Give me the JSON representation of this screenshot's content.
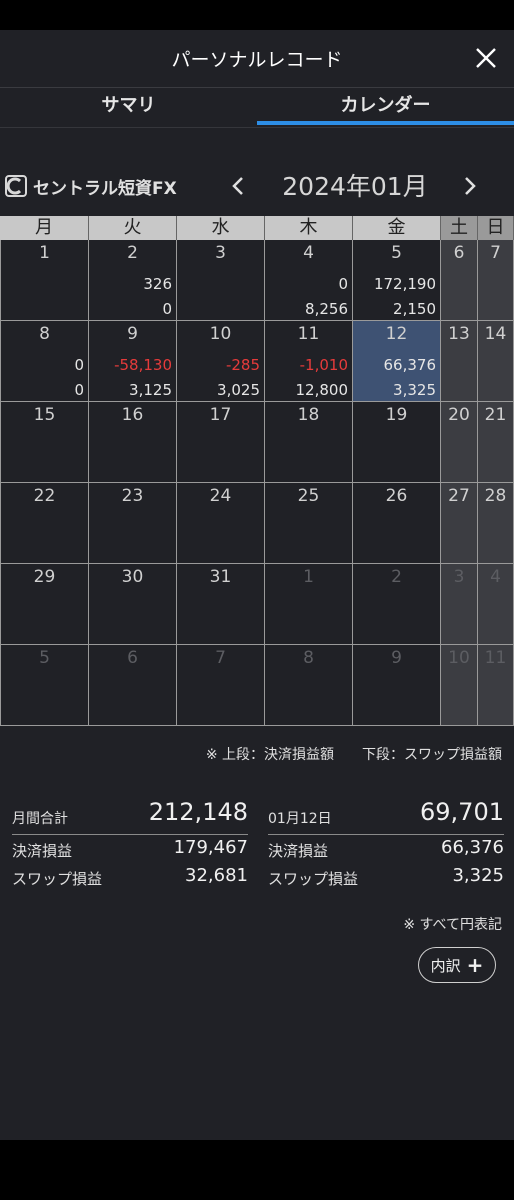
{
  "header": {
    "title": "パーソナルレコード"
  },
  "tabs": [
    {
      "label": "サマリ",
      "active": false
    },
    {
      "label": "カレンダー",
      "active": true
    }
  ],
  "brand": {
    "logo_text": "セントラル短資FX"
  },
  "month_nav": {
    "label": "2024年01月",
    "prev": "‹",
    "next": "›"
  },
  "calendar": {
    "weekdays": [
      "月",
      "火",
      "水",
      "木",
      "金",
      "土",
      "日"
    ],
    "weeks": [
      [
        {
          "day": "1",
          "top": "",
          "bottom": ""
        },
        {
          "day": "2",
          "top": "326",
          "bottom": "0"
        },
        {
          "day": "3",
          "top": "",
          "bottom": ""
        },
        {
          "day": "4",
          "top": "0",
          "bottom": "8,256"
        },
        {
          "day": "5",
          "top": "172,190",
          "bottom": "2,150"
        },
        {
          "day": "6",
          "top": "",
          "bottom": ""
        },
        {
          "day": "7",
          "top": "",
          "bottom": ""
        }
      ],
      [
        {
          "day": "8",
          "top": "0",
          "bottom": "0"
        },
        {
          "day": "9",
          "top": "-58,130",
          "bottom": "3,125",
          "top_negative": true
        },
        {
          "day": "10",
          "top": "-285",
          "bottom": "3,025",
          "top_negative": true
        },
        {
          "day": "11",
          "top": "-1,010",
          "bottom": "12,800",
          "top_negative": true
        },
        {
          "day": "12",
          "top": "66,376",
          "bottom": "3,325",
          "selected": true
        },
        {
          "day": "13",
          "top": "",
          "bottom": ""
        },
        {
          "day": "14",
          "top": "",
          "bottom": ""
        }
      ],
      [
        {
          "day": "15"
        },
        {
          "day": "16"
        },
        {
          "day": "17"
        },
        {
          "day": "18"
        },
        {
          "day": "19"
        },
        {
          "day": "20"
        },
        {
          "day": "21"
        }
      ],
      [
        {
          "day": "22"
        },
        {
          "day": "23"
        },
        {
          "day": "24"
        },
        {
          "day": "25"
        },
        {
          "day": "26"
        },
        {
          "day": "27"
        },
        {
          "day": "28"
        }
      ],
      [
        {
          "day": "29"
        },
        {
          "day": "30"
        },
        {
          "day": "31"
        },
        {
          "day": "1",
          "muted": true
        },
        {
          "day": "2",
          "muted": true
        },
        {
          "day": "3",
          "muted": true
        },
        {
          "day": "4",
          "muted": true
        }
      ],
      [
        {
          "day": "5",
          "muted": true
        },
        {
          "day": "6",
          "muted": true
        },
        {
          "day": "7",
          "muted": true
        },
        {
          "day": "8",
          "muted": true
        },
        {
          "day": "9",
          "muted": true
        },
        {
          "day": "10",
          "muted": true
        },
        {
          "day": "11",
          "muted": true
        }
      ]
    ]
  },
  "legend": "※ 上段：決済損益額　　下段：スワップ損益額",
  "summary": {
    "month": {
      "label": "月間合計",
      "total": "212,148",
      "settle_label": "決済損益",
      "settle_value": "179,467",
      "swap_label": "スワップ損益",
      "swap_value": "32,681"
    },
    "day": {
      "label": "01月12日",
      "total": "69,701",
      "settle_label": "決済損益",
      "settle_value": "66,376",
      "swap_label": "スワップ損益",
      "swap_value": "3,325"
    }
  },
  "note": "※ すべて円表記",
  "breakdown_button": {
    "label": "内訳",
    "icon": "plus-icon"
  },
  "colors": {
    "accent": "#2d8ee6",
    "negative": "#e53b3b",
    "selected": "#3e5273",
    "weekend": "#3c3d42",
    "background": "#202126"
  }
}
